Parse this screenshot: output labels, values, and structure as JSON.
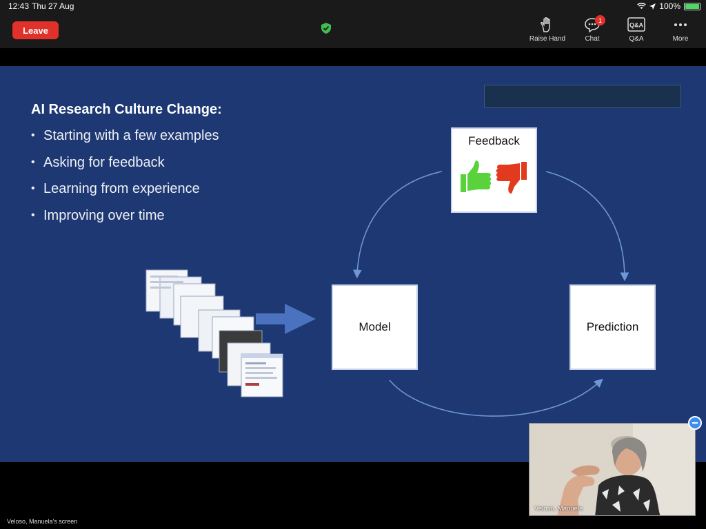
{
  "status": {
    "time": "12:43",
    "date": "Thu 27 Aug",
    "battery": "100%"
  },
  "toolbar": {
    "leave_label": "Leave",
    "items": [
      {
        "label": "Raise Hand",
        "icon": "raise-hand-icon"
      },
      {
        "label": "Chat",
        "icon": "chat-icon",
        "badge": "1"
      },
      {
        "label": "Q&A",
        "icon": "qa-icon"
      },
      {
        "label": "More",
        "icon": "more-icon"
      }
    ],
    "qa_icon_text": "Q&A"
  },
  "slide": {
    "title": "AI Research Culture Change:",
    "bullets": [
      "Starting with a few examples",
      "Asking for feedback",
      "Learning from experience",
      "Improving over time"
    ],
    "boxes": {
      "model": "Model",
      "prediction": "Prediction",
      "feedback": "Feedback"
    }
  },
  "footer": {
    "screen_label": "Veloso, Manuela's screen",
    "video_name": "Veloso, Manuela"
  },
  "colors": {
    "slide_bg": "#1d3872",
    "leave": "#e0322b",
    "thumb_up": "#5ad23c",
    "thumb_down": "#e23a1e"
  }
}
